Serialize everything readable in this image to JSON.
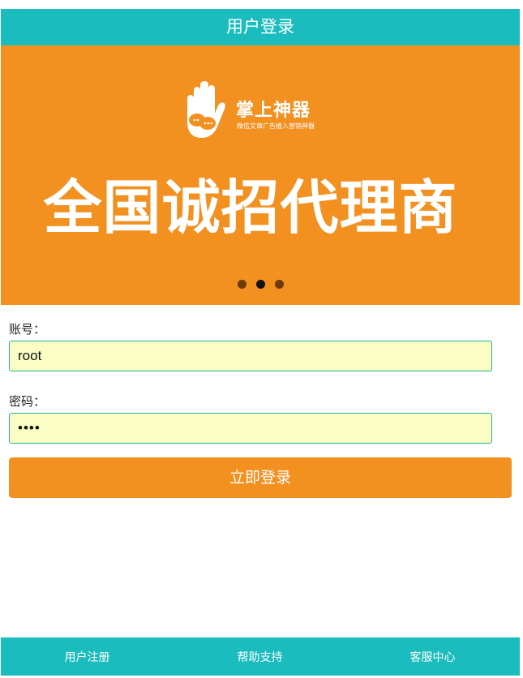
{
  "header": {
    "title": "用户登录"
  },
  "banner": {
    "logo_icon": "hand-chat-logo-icon",
    "brand_name": "掌上神器",
    "brand_tagline": "微信文章广告植入营销神器",
    "headline": "全国诚招代理商",
    "carousel_total": 3,
    "carousel_active_index": 1
  },
  "form": {
    "account_label": "账号：",
    "account_value": "root",
    "password_label": "密码：",
    "password_value": "••••",
    "login_button": "立即登录"
  },
  "footer": {
    "items": [
      {
        "label": "用户注册"
      },
      {
        "label": "帮助支持"
      },
      {
        "label": "客服中心"
      }
    ]
  },
  "colors": {
    "teal": "#1bbcbd",
    "orange": "#f29020",
    "input_background": "#fbfec4",
    "input_border": "#1bb79c"
  }
}
